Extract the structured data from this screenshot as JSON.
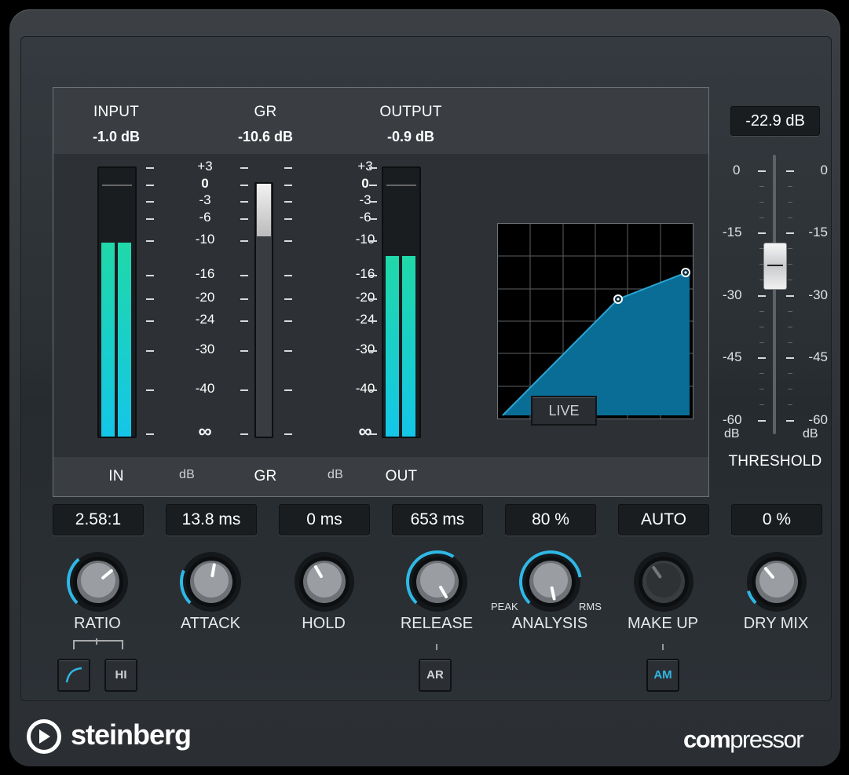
{
  "meters": {
    "input": {
      "label": "INPUT",
      "value": "-1.0 dB",
      "foot": "IN",
      "level": 0.73
    },
    "gr": {
      "label": "GR",
      "value": "-10.6 dB",
      "foot": "GR",
      "level": 0.21
    },
    "output": {
      "label": "OUTPUT",
      "value": "-0.9 dB",
      "foot": "OUT",
      "level": 0.68
    },
    "db_label_1": "dB",
    "db_label_2": "dB",
    "scale": [
      "+3",
      "0",
      "-3",
      "-6",
      "-10",
      "-16",
      "-20",
      "-24",
      "-30",
      "-40",
      "∞"
    ]
  },
  "live_button": "LIVE",
  "threshold": {
    "value": "-22.9 dB",
    "label": "THRESHOLD",
    "left_scale": [
      "0",
      "-15",
      "-30",
      "-45",
      "-60"
    ],
    "right_scale": [
      "0",
      "-15",
      "-30",
      "-45",
      "-60"
    ],
    "unit_left": "dB",
    "unit_right": "dB"
  },
  "controls": [
    {
      "label": "RATIO",
      "value": "2.58:1"
    },
    {
      "label": "ATTACK",
      "value": "13.8 ms"
    },
    {
      "label": "HOLD",
      "value": "0 ms"
    },
    {
      "label": "RELEASE",
      "value": "653 ms"
    },
    {
      "label": "ANALYSIS",
      "value": "80 %"
    },
    {
      "label": "MAKE UP",
      "value": "AUTO"
    },
    {
      "label": "DRY MIX",
      "value": "0 %"
    }
  ],
  "analysis_peak": "PEAK",
  "analysis_rms": "RMS",
  "buttons": {
    "soft_knee_icon": "soft-knee-icon",
    "hi": "HI",
    "ar": "AR",
    "am": "AM"
  },
  "brand": {
    "company": "steinberg",
    "product_prefix": "com",
    "product_suffix": "pressor"
  },
  "colors": {
    "accent": "#2fb8e6",
    "meter": "#1fd6b4",
    "graph_fill": "#0a6d96"
  }
}
